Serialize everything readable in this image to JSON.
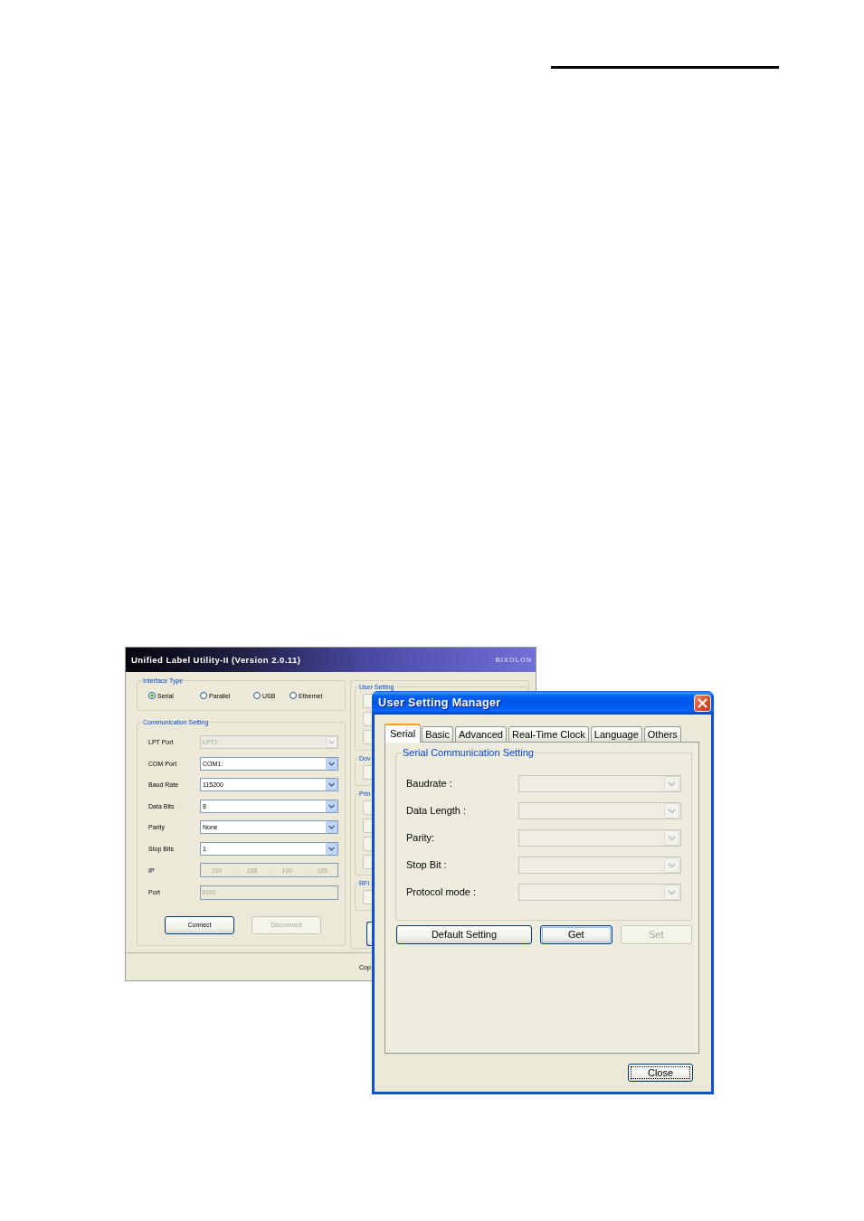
{
  "main_window": {
    "title": "Unified Label Utility-II (Version 2.0.11)",
    "brand": "BIXOLON",
    "interface_type": {
      "title": "Interface Type",
      "options": [
        {
          "label": "Serial",
          "selected": true
        },
        {
          "label": "Parallel",
          "selected": false
        },
        {
          "label": "USB",
          "selected": false
        },
        {
          "label": "Ethernet",
          "selected": false
        }
      ]
    },
    "communication_setting": {
      "title": "Communication Setting",
      "fields": [
        {
          "label": "LPT Port",
          "kind": "dropdown",
          "value": "LPT1:",
          "disabled": true
        },
        {
          "label": "COM Port",
          "kind": "dropdown",
          "value": "COM1:",
          "disabled": false
        },
        {
          "label": "Baud Rate",
          "kind": "dropdown",
          "value": "115200",
          "disabled": false
        },
        {
          "label": "Data Bits",
          "kind": "dropdown",
          "value": "8",
          "disabled": false
        },
        {
          "label": "Parity",
          "kind": "dropdown",
          "value": "None",
          "disabled": false
        },
        {
          "label": "Stop Bits",
          "kind": "dropdown",
          "value": "1",
          "disabled": false
        },
        {
          "label": "IP",
          "kind": "ip",
          "parts": [
            "192",
            ".",
            "168",
            ".",
            "100",
            ".",
            "185"
          ],
          "disabled": true
        },
        {
          "label": "Port",
          "kind": "text",
          "value": "9100",
          "disabled": true
        }
      ],
      "buttons": [
        {
          "label": "Connect",
          "disabled": false
        },
        {
          "label": "Disconnect",
          "disabled": true
        }
      ]
    },
    "side_panel": {
      "groups": [
        {
          "title": "User Setting",
          "buttons": [
            {
              "disabled": true
            },
            {
              "disabled": true
            },
            {
              "disabled": true
            }
          ]
        },
        {
          "title": "Dov",
          "buttons": [
            {
              "disabled": true
            }
          ]
        },
        {
          "title": "Prin",
          "buttons": [
            {
              "disabled": true
            },
            {
              "disabled": true
            },
            {
              "disabled": true
            },
            {
              "disabled": true
            }
          ]
        },
        {
          "title": "RFI",
          "buttons": [
            {
              "disabled": true
            }
          ]
        }
      ],
      "button": {
        "disabled": false
      }
    },
    "status_text": "Cop"
  },
  "dialog": {
    "title": "User Setting Manager",
    "tabs": [
      {
        "label": "Serial",
        "selected": true
      },
      {
        "label": "Basic",
        "selected": false
      },
      {
        "label": "Advanced",
        "selected": false
      },
      {
        "label": "Real-Time Clock",
        "selected": false
      },
      {
        "label": "Language",
        "selected": false
      },
      {
        "label": "Others",
        "selected": false
      }
    ],
    "group": {
      "title": "Serial Communication Setting",
      "fields": [
        {
          "label": "Baudrate :",
          "disabled": true
        },
        {
          "label": "Data Length :",
          "disabled": true
        },
        {
          "label": "Parity:",
          "disabled": true
        },
        {
          "label": "Stop Bit :",
          "disabled": true
        },
        {
          "label": "Protocol mode :",
          "disabled": true
        }
      ]
    },
    "buttons": [
      {
        "label": "Default Setting",
        "disabled": false,
        "default": false
      },
      {
        "label": "Get",
        "disabled": false,
        "default": true
      },
      {
        "label": "Set",
        "disabled": true,
        "default": false
      }
    ],
    "close_button": {
      "label": "Close",
      "focused": true
    }
  }
}
